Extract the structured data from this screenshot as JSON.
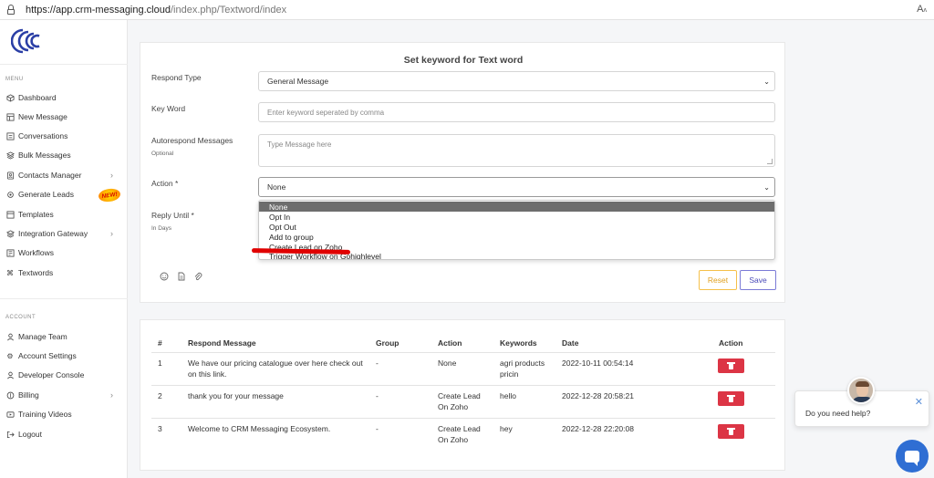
{
  "browser": {
    "url_host": "https://app.crm-messaging.cloud",
    "url_path": "/index.php/Textword/index",
    "reader_icon": "reader-mode-icon"
  },
  "brand": {
    "logo_color": "#2b3fa6"
  },
  "sidebar": {
    "menu_heading": "MENU",
    "account_heading": "ACCOUNT",
    "new_badge": "NEW!",
    "menu_items": [
      {
        "label": "Dashboard",
        "icon": "cube-icon"
      },
      {
        "label": "New Message",
        "icon": "table-icon"
      },
      {
        "label": "Conversations",
        "icon": "list-icon"
      },
      {
        "label": "Bulk Messages",
        "icon": "layers-icon"
      },
      {
        "label": "Contacts Manager",
        "icon": "contacts-icon"
      },
      {
        "label": "Generate Leads",
        "icon": "settings-icon"
      },
      {
        "label": "Templates",
        "icon": "template-icon"
      },
      {
        "label": "Integration Gateway",
        "icon": "layers-icon"
      },
      {
        "label": "Workflows",
        "icon": "workflow-icon"
      },
      {
        "label": "Textwords",
        "icon": "command-icon"
      }
    ],
    "account_items": [
      {
        "label": "Manage Team",
        "icon": "user-icon"
      },
      {
        "label": "Account Settings",
        "icon": "gear-icon"
      },
      {
        "label": "Developer Console",
        "icon": "user-icon"
      },
      {
        "label": "Billing",
        "icon": "billing-icon"
      },
      {
        "label": "Training Videos",
        "icon": "video-icon"
      },
      {
        "label": "Logout",
        "icon": "logout-icon"
      }
    ]
  },
  "form": {
    "title": "Set keyword for Text word",
    "respond_type_label": "Respond Type",
    "respond_type_value": "General Message",
    "keyword_label": "Key Word",
    "keyword_placeholder": "Enter keyword seperated by comma",
    "autorespond_label": "Autorespond Messages",
    "autorespond_sub": "Optional",
    "autorespond_placeholder": "Type Message here",
    "action_label": "Action *",
    "action_value": "None",
    "reply_label": "Reply Until *",
    "reply_sub": "In Days",
    "action_options": [
      "None",
      "Opt In",
      "Opt Out",
      "Add to group",
      "Create Lead on Zoho",
      "Trigger Workflow on Gohighlevel"
    ],
    "selected_option": "None",
    "reset_label": "Reset",
    "save_label": "Save"
  },
  "table": {
    "headers": [
      "#",
      "Respond Message",
      "Group",
      "Action",
      "Keywords",
      "Date",
      "Action"
    ],
    "rows": [
      {
        "num": "1",
        "message_1": "We have our pricing catalogue over here check out",
        "message_2": "on this link.",
        "group": "-",
        "action_1": "None",
        "action_2": "",
        "keywords_1": "agri products",
        "keywords_2": "pricin",
        "date": "2022-10-11 00:54:14"
      },
      {
        "num": "2",
        "message_1": "thank you for your message",
        "message_2": "",
        "group": "-",
        "action_1": "Create Lead",
        "action_2": "On Zoho",
        "keywords_1": "hello",
        "keywords_2": "",
        "date": "2022-12-28 20:58:21"
      },
      {
        "num": "3",
        "message_1": "Welcome to CRM Messaging Ecosystem.",
        "message_2": "",
        "group": "-",
        "action_1": "Create Lead",
        "action_2": "On Zoho",
        "keywords_1": "hey",
        "keywords_2": "",
        "date": "2022-12-28 22:20:08"
      }
    ]
  },
  "chat": {
    "prompt": "Do you need help?"
  },
  "colors": {
    "delete_button": "#dc3545",
    "chat_fab": "#2f6ed3",
    "save_border": "#7b7bd6",
    "reset_border": "#f5c04a"
  }
}
